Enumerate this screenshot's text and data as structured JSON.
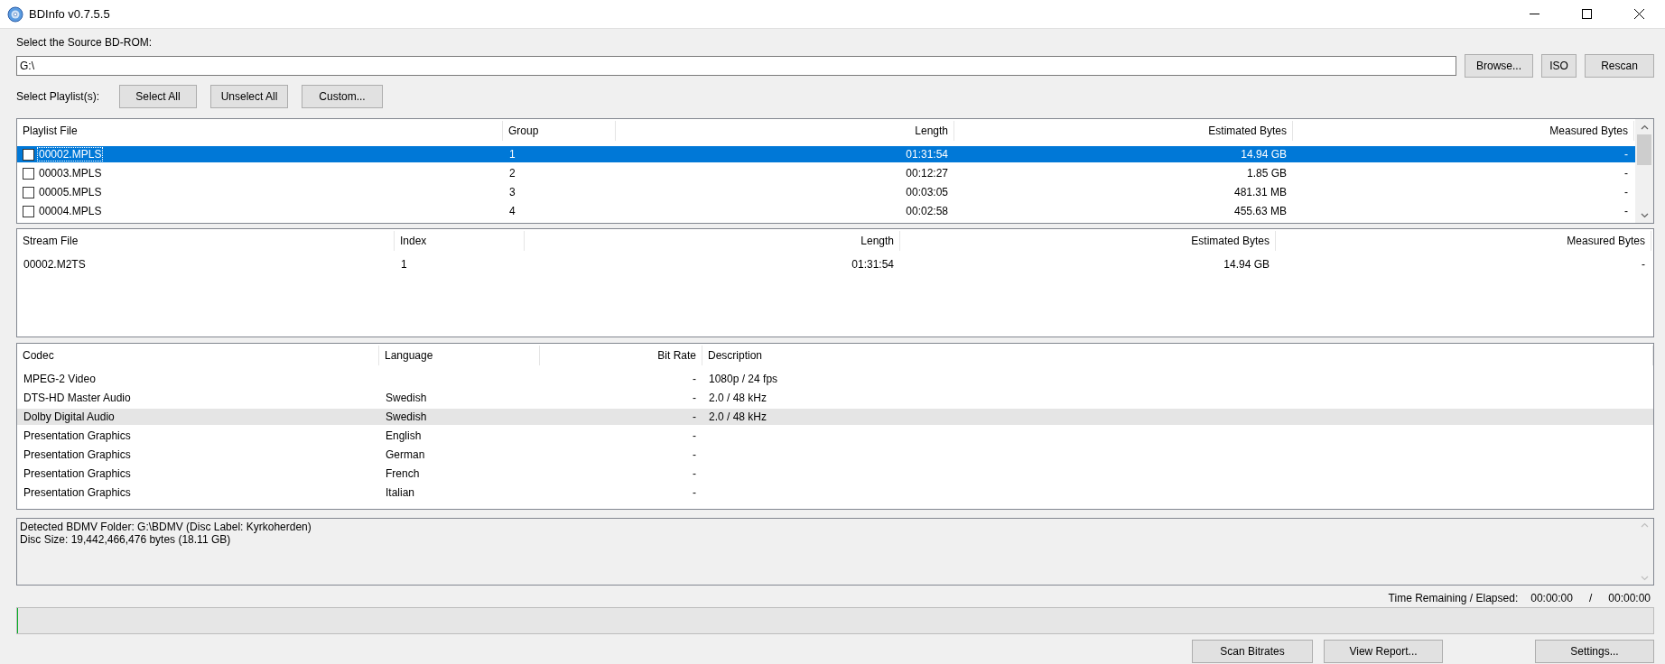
{
  "window": {
    "title": "BDInfo v0.7.5.5"
  },
  "source": {
    "label": "Select the Source BD-ROM:",
    "value": "G:\\",
    "buttons": [
      "Browse...",
      "ISO",
      "Rescan"
    ]
  },
  "playlist_selection": {
    "label": "Select Playlist(s):",
    "buttons": [
      "Select All",
      "Unselect All",
      "Custom..."
    ]
  },
  "playlists": {
    "columns": [
      "Playlist File",
      "Group",
      "Length",
      "Estimated Bytes",
      "Measured Bytes"
    ],
    "rows": [
      {
        "checked": false,
        "selected": true,
        "cells": [
          "00002.MPLS",
          "1",
          "01:31:54",
          "14.94 GB",
          "-"
        ]
      },
      {
        "checked": false,
        "selected": false,
        "cells": [
          "00003.MPLS",
          "2",
          "00:12:27",
          "1.85 GB",
          "-"
        ]
      },
      {
        "checked": false,
        "selected": false,
        "cells": [
          "00005.MPLS",
          "3",
          "00:03:05",
          "481.31 MB",
          "-"
        ]
      },
      {
        "checked": false,
        "selected": false,
        "cells": [
          "00004.MPLS",
          "4",
          "00:02:58",
          "455.63 MB",
          "-"
        ]
      }
    ]
  },
  "streams": {
    "columns": [
      "Stream File",
      "Index",
      "Length",
      "Estimated Bytes",
      "Measured Bytes"
    ],
    "rows": [
      {
        "cells": [
          "00002.M2TS",
          "1",
          "01:31:54",
          "14.94 GB",
          "-"
        ]
      }
    ]
  },
  "codecs": {
    "columns": [
      "Codec",
      "Language",
      "Bit Rate",
      "Description"
    ],
    "rows": [
      {
        "highlighted": false,
        "codec": "MPEG-2 Video",
        "bit_rate": "-",
        "description": "1080p / 24 fps"
      },
      {
        "highlighted": false,
        "codec": "DTS-HD Master Audio",
        "language": "Swedish",
        "bit_rate": "-",
        "description": "2.0 / 48 kHz"
      },
      {
        "highlighted": true,
        "codec": "Dolby Digital Audio",
        "language": "Swedish",
        "bit_rate": "-",
        "description": "2.0 / 48 kHz"
      },
      {
        "highlighted": false,
        "codec": "Presentation Graphics",
        "language": "English",
        "bit_rate": "-"
      },
      {
        "highlighted": false,
        "codec": "Presentation Graphics",
        "language": "German",
        "bit_rate": "-"
      },
      {
        "highlighted": false,
        "codec": "Presentation Graphics",
        "language": "French",
        "bit_rate": "-"
      },
      {
        "highlighted": false,
        "codec": "Presentation Graphics",
        "language": "Italian",
        "bit_rate": "-"
      }
    ]
  },
  "log": {
    "lines": [
      "Detected BDMV Folder: G:\\BDMV (Disc Label: Kyrkoherden)",
      "Disc Size: 19,442,466,476 bytes (18.11 GB)"
    ]
  },
  "time": {
    "label": "Time Remaining / Elapsed:",
    "remaining": "00:00:00",
    "separator": "/",
    "elapsed": "00:00:00"
  },
  "progress": {
    "level": 0
  },
  "actions": [
    "Scan Bitrates",
    "View Report...",
    "Settings..."
  ]
}
